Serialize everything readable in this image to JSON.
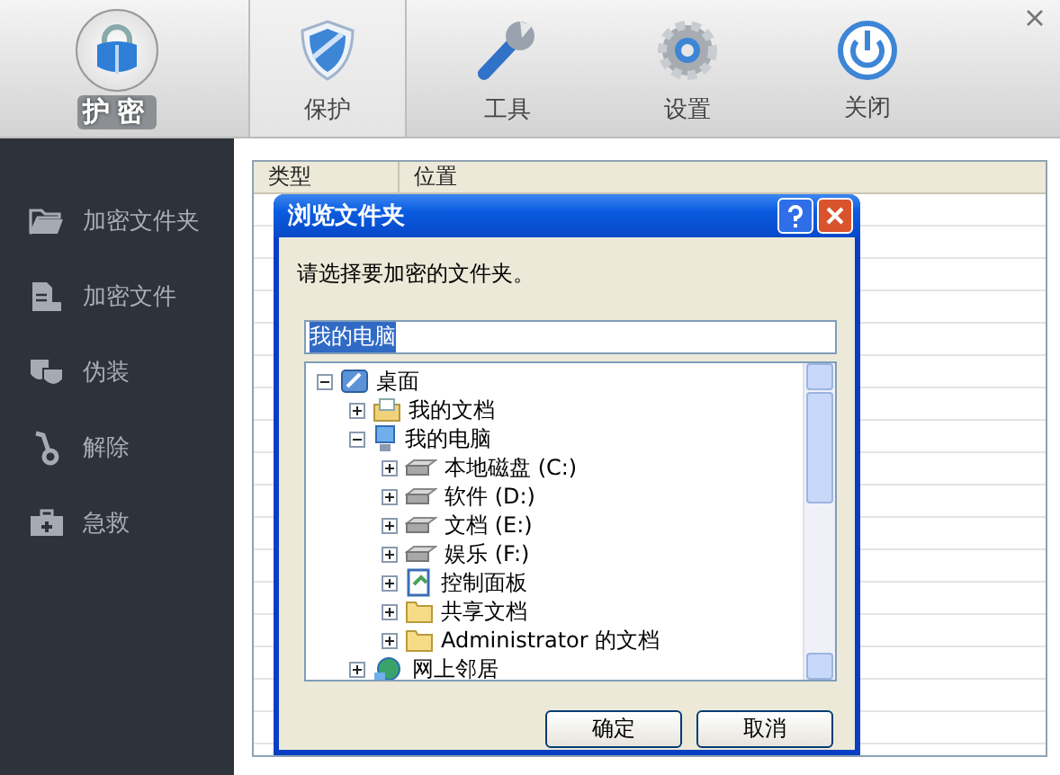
{
  "app": {
    "logo_text": "护密"
  },
  "tabs": [
    {
      "label": "保护",
      "kind": "shield",
      "selected": true
    },
    {
      "label": "工具",
      "kind": "wrench",
      "selected": false
    },
    {
      "label": "设置",
      "kind": "gear",
      "selected": false
    },
    {
      "label": "关闭",
      "kind": "power",
      "selected": false
    }
  ],
  "sidebar": {
    "items": [
      {
        "label": "加密文件夹",
        "kind": "folder"
      },
      {
        "label": "加密文件",
        "kind": "file-lock"
      },
      {
        "label": "伪装",
        "kind": "mask"
      },
      {
        "label": "解除",
        "kind": "key"
      },
      {
        "label": "急救",
        "kind": "kit"
      }
    ]
  },
  "table": {
    "columns": [
      "类型",
      "位置"
    ]
  },
  "dialog": {
    "title": "浏览文件夹",
    "prompt": "请选择要加密的文件夹。",
    "path_value": "我的电脑",
    "tree": [
      {
        "label": "桌面",
        "kind": "desktop",
        "expanded": true,
        "children": [
          {
            "label": "我的文档",
            "kind": "documents",
            "expanded": false
          },
          {
            "label": "我的电脑",
            "kind": "computer",
            "expanded": true,
            "children": [
              {
                "label": "本地磁盘 (C:)",
                "kind": "drive",
                "expanded": false
              },
              {
                "label": "软件 (D:)",
                "kind": "drive",
                "expanded": false
              },
              {
                "label": "文档 (E:)",
                "kind": "drive",
                "expanded": false
              },
              {
                "label": "娱乐 (F:)",
                "kind": "drive",
                "expanded": false
              },
              {
                "label": "控制面板",
                "kind": "control-panel",
                "expanded": false
              },
              {
                "label": "共享文档",
                "kind": "folder",
                "expanded": false
              },
              {
                "label": "Administrator 的文档",
                "kind": "folder",
                "expanded": false
              }
            ]
          },
          {
            "label": "网上邻居",
            "kind": "network",
            "expanded": false
          }
        ]
      }
    ],
    "buttons": [
      "确定",
      "取消"
    ]
  }
}
